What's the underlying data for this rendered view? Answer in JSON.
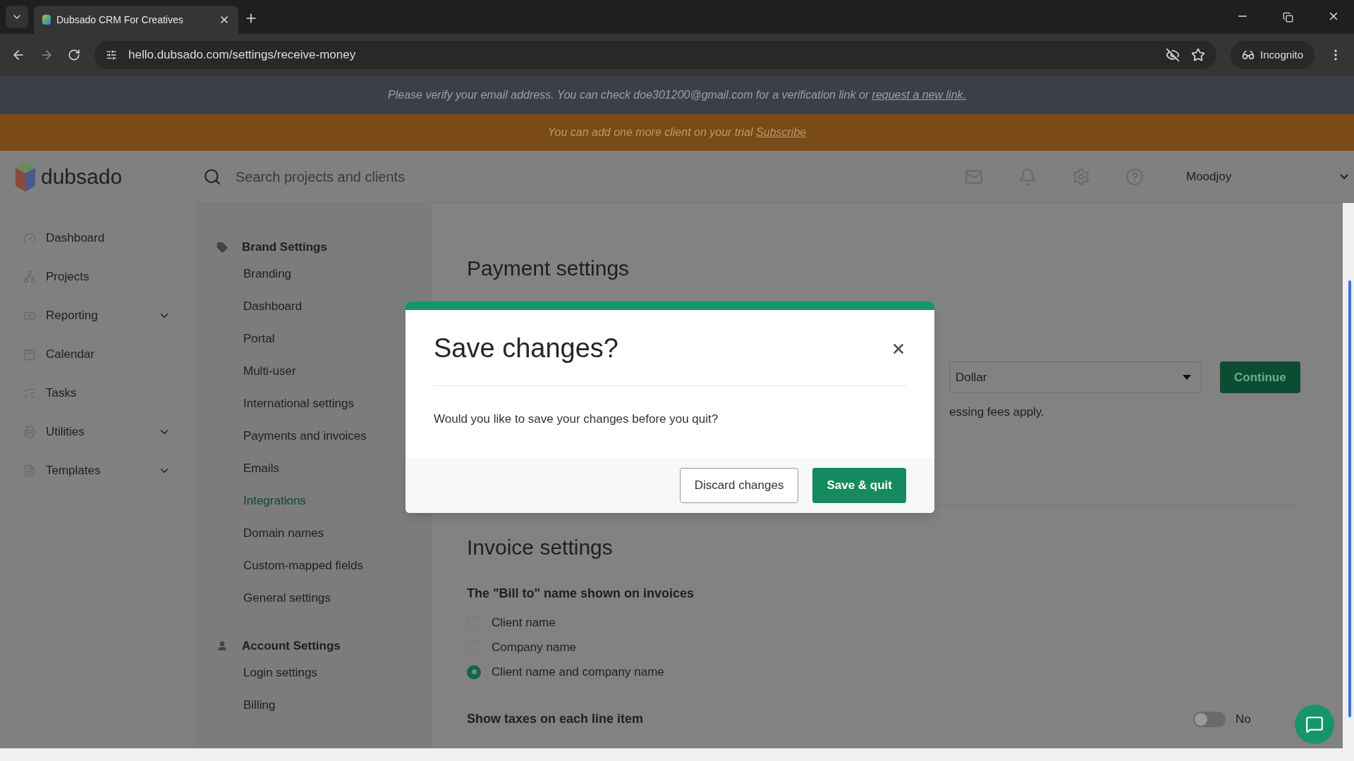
{
  "browser": {
    "tab_title": "Dubsado CRM For Creatives",
    "url": "hello.dubsado.com/settings/receive-money",
    "profile": "Incognito"
  },
  "verify_banner": {
    "text": "Please verify your email address. You can check doe301200@gmail.com for a verification link or",
    "link": "request a new link."
  },
  "trial_banner": {
    "text": "You can add one more client on your trial",
    "link": "Subscribe"
  },
  "header": {
    "logo": "dubsado",
    "search_placeholder": "Search projects and clients",
    "user": "Moodjoy"
  },
  "nav": [
    {
      "label": "Dashboard",
      "expandable": false
    },
    {
      "label": "Projects",
      "expandable": false
    },
    {
      "label": "Reporting",
      "expandable": true
    },
    {
      "label": "Calendar",
      "expandable": false
    },
    {
      "label": "Tasks",
      "expandable": false
    },
    {
      "label": "Utilities",
      "expandable": true
    },
    {
      "label": "Templates",
      "expandable": true
    }
  ],
  "settings_menu": [
    {
      "title": "Brand Settings",
      "items": [
        {
          "label": "Branding",
          "selected": false
        },
        {
          "label": "Dashboard",
          "selected": false
        },
        {
          "label": "Portal",
          "selected": false
        },
        {
          "label": "Multi-user",
          "selected": false
        },
        {
          "label": "International settings",
          "selected": false
        },
        {
          "label": "Payments and invoices",
          "selected": false
        },
        {
          "label": "Emails",
          "selected": false
        },
        {
          "label": "Integrations",
          "selected": true
        },
        {
          "label": "Domain names",
          "selected": false
        },
        {
          "label": "Custom-mapped fields",
          "selected": false
        },
        {
          "label": "General settings",
          "selected": false
        }
      ]
    },
    {
      "title": "Account Settings",
      "items": [
        {
          "label": "Login settings",
          "selected": false
        },
        {
          "label": "Billing",
          "selected": false
        }
      ]
    }
  ],
  "payment_settings": {
    "title": "Payment settings",
    "currency": "Dollar",
    "note": "essing fees apply.",
    "button": "Continue"
  },
  "invoice_settings": {
    "title": "Invoice settings",
    "question": "The \"Bill to\" name shown on invoices",
    "options": [
      {
        "label": "Client name",
        "selected": false
      },
      {
        "label": "Company name",
        "selected": false
      },
      {
        "label": "Client name and company name",
        "selected": true
      }
    ],
    "taxes": {
      "label": "Show taxes on each line item",
      "on": false,
      "state_label": "No"
    }
  },
  "dialog": {
    "title": "Save changes?",
    "message": "Would you like to save your changes before you quit?",
    "buttons": [
      {
        "label": "Discard changes",
        "kind": "secondary"
      },
      {
        "label": "Save & quit",
        "kind": "primary"
      }
    ]
  }
}
